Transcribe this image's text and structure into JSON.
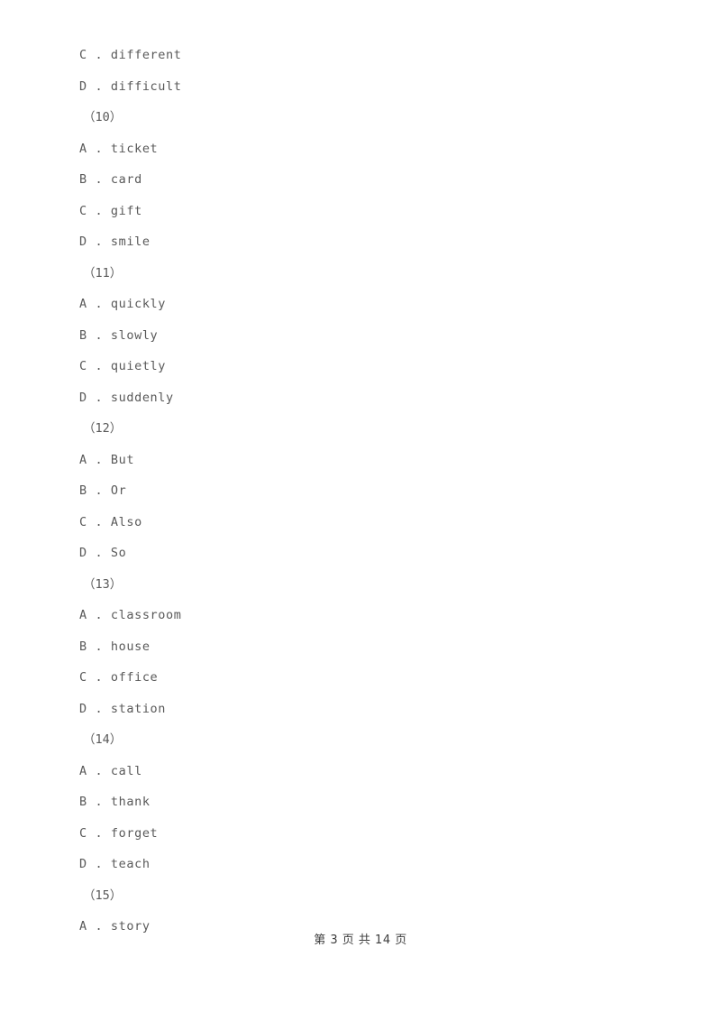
{
  "document": {
    "page_background": "#ffffff",
    "text_color": "#595959",
    "footer_color": "#3d3d3d"
  },
  "body_lines": [
    {
      "kind": "option",
      "text": "C . different"
    },
    {
      "kind": "option",
      "text": "D . difficult"
    },
    {
      "kind": "qnum",
      "text": "（10）"
    },
    {
      "kind": "option",
      "text": "A . ticket"
    },
    {
      "kind": "option",
      "text": "B . card"
    },
    {
      "kind": "option",
      "text": "C . gift"
    },
    {
      "kind": "option",
      "text": "D . smile"
    },
    {
      "kind": "qnum",
      "text": "（11）"
    },
    {
      "kind": "option",
      "text": "A . quickly"
    },
    {
      "kind": "option",
      "text": "B . slowly"
    },
    {
      "kind": "option",
      "text": "C . quietly"
    },
    {
      "kind": "option",
      "text": "D . suddenly"
    },
    {
      "kind": "qnum",
      "text": "（12）"
    },
    {
      "kind": "option",
      "text": "A . But"
    },
    {
      "kind": "option",
      "text": "B . Or"
    },
    {
      "kind": "option",
      "text": "C . Also"
    },
    {
      "kind": "option",
      "text": "D . So"
    },
    {
      "kind": "qnum",
      "text": "（13）"
    },
    {
      "kind": "option",
      "text": "A . classroom"
    },
    {
      "kind": "option",
      "text": "B . house"
    },
    {
      "kind": "option",
      "text": "C . office"
    },
    {
      "kind": "option",
      "text": "D . station"
    },
    {
      "kind": "qnum",
      "text": "（14）"
    },
    {
      "kind": "option",
      "text": "A . call"
    },
    {
      "kind": "option",
      "text": "B . thank"
    },
    {
      "kind": "option",
      "text": "C . forget"
    },
    {
      "kind": "option",
      "text": "D . teach"
    },
    {
      "kind": "qnum",
      "text": "（15）"
    },
    {
      "kind": "option",
      "text": "A . story"
    }
  ],
  "footer": {
    "text": "第 3 页 共 14 页",
    "current_page": "3",
    "total_pages": "14"
  }
}
